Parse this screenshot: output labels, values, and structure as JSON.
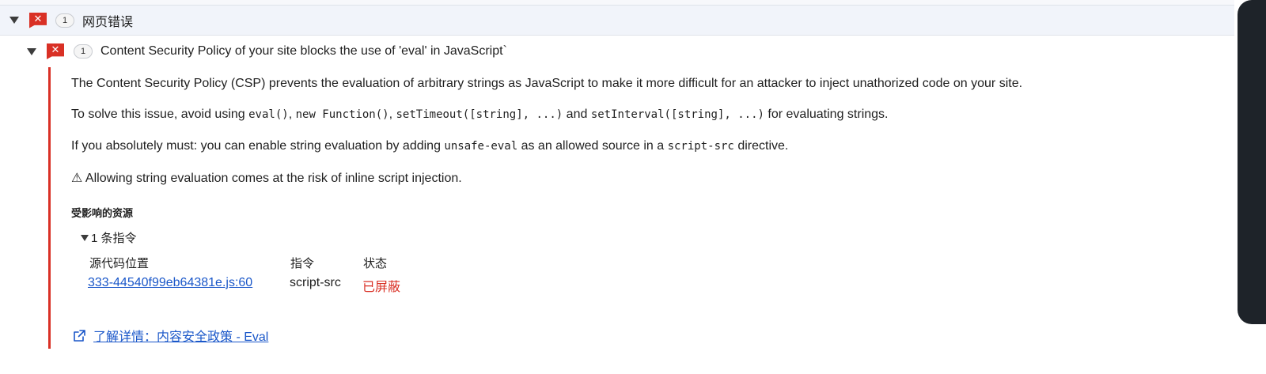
{
  "group": {
    "count": "1",
    "title": "网页错误"
  },
  "issue": {
    "count": "1",
    "title": "Content Security Policy of your site blocks the use of 'eval' in JavaScript`"
  },
  "details": {
    "p1": "The Content Security Policy (CSP) prevents the evaluation of arbitrary strings as JavaScript to make it more difficult for an attacker to inject unathorized code on your site.",
    "p2": {
      "a": "To solve this issue, avoid using ",
      "c1": "eval()",
      "s1": ", ",
      "c2": "new Function()",
      "s2": ", ",
      "c3": "setTimeout([string], ...)",
      "s3": " and ",
      "c4": "setInterval([string], ...)",
      "s4": " for evaluating strings."
    },
    "p3": {
      "a": "If you absolutely must: you can enable string evaluation by adding ",
      "c1": "unsafe-eval",
      "b": " as an allowed source in a ",
      "c2": "script-src",
      "c": " directive."
    },
    "warning_glyph": "⚠",
    "warning": "Allowing string evaluation comes at the risk of inline script injection.",
    "affected_heading": "受影响的资源",
    "instructions_toggle": "1 条指令",
    "columns": {
      "source": "源代码位置",
      "directive": "指令",
      "status": "状态"
    },
    "rows": [
      {
        "source": "333-44540f99eb64381e.js:60",
        "directive": "script-src",
        "status": "已屏蔽"
      }
    ],
    "learn_more": "了解详情：内容安全政策 - Eval"
  },
  "colors": {
    "error": "#d93025",
    "link": "#1a57c9",
    "header_bg": "#f1f4fa"
  },
  "icons": {
    "error": "error-flag-icon",
    "expand": "triangle-down-icon",
    "external": "external-link-icon",
    "warning": "warning-icon"
  }
}
